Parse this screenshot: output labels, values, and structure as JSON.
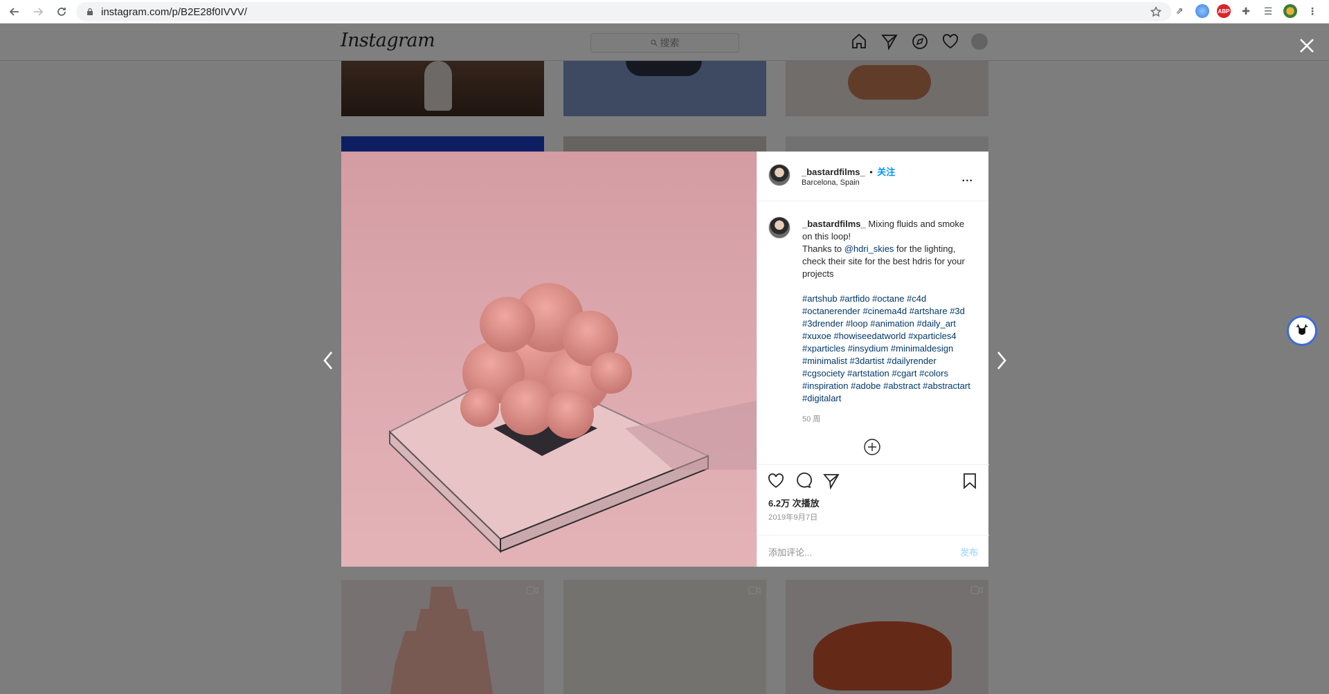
{
  "browser": {
    "url": "instagram.com/p/B2E28f0IVVV/"
  },
  "ig": {
    "logo": "Instagram",
    "search_placeholder": "搜索"
  },
  "post": {
    "username": "_bastardfilms_",
    "separator": "•",
    "follow": "关注",
    "location": "Barcelona, Spain",
    "more": "...",
    "caption_user": "_bastardfilms_",
    "caption_l1": " Mixing fluids and smoke on this loop!",
    "caption_l2a": "Thanks to ",
    "caption_mention": "@hdri_skies",
    "caption_l2b": " for the lighting, check their site for the best hdris for your projects",
    "hashtags": "#artshub #artfido #octane #c4d #octanerender #cinema4d #artshare #3d #3drender #loop #animation #daily_art #xuxoe #howiseedatworld #xparticles4 #xparticles #insydium #minimaldesign #minimalist #3dartist #dailyrender #cgsociety #artstation #cgart #colors #inspiration #adobe #abstract #abstractart #digitalart",
    "time_ago": "50 周",
    "views": "6.2万 次播放",
    "date": "2019年9月7日",
    "comment_placeholder": "添加评论...",
    "post_button": "发布"
  },
  "colors": {
    "link_blue": "#0095f6",
    "hashtag": "#00376b",
    "media_pink": "#d49ca3"
  }
}
